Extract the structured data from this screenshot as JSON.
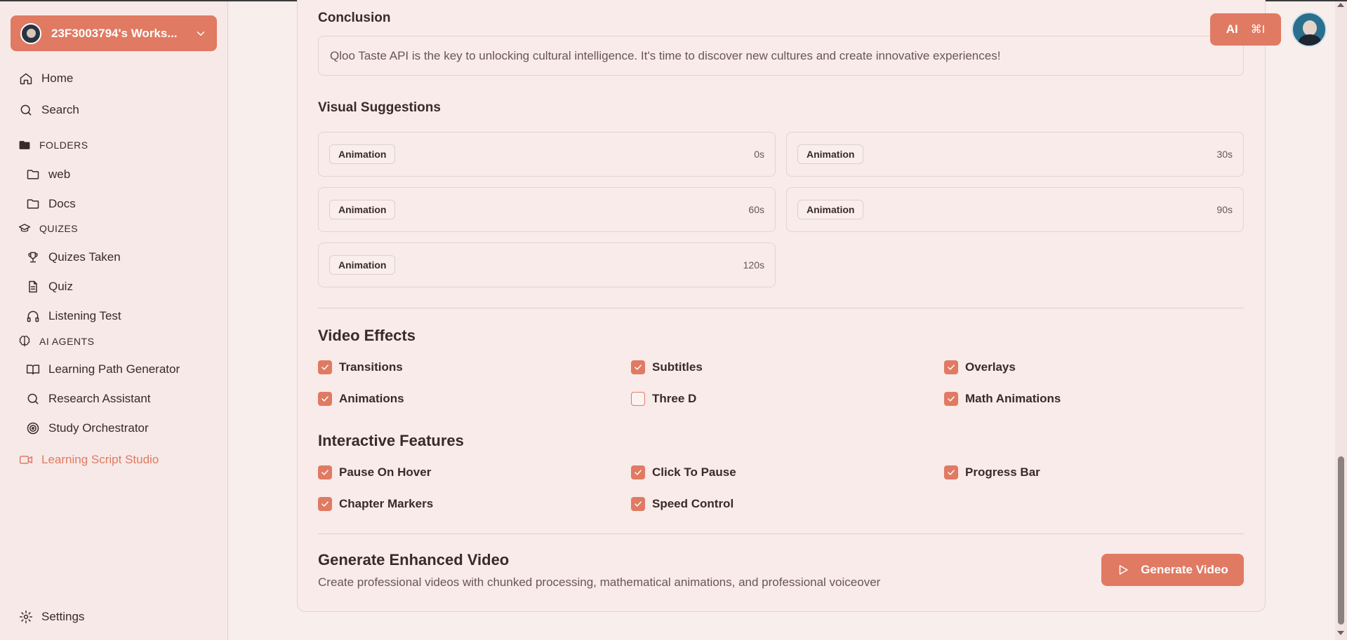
{
  "workspace": {
    "name": "23F3003794's Works..."
  },
  "nav": {
    "home": "Home",
    "search": "Search",
    "folders_header": "FOLDERS",
    "folders": [
      "web",
      "Docs"
    ],
    "quizes_header": "QUIZES",
    "quizes": [
      "Quizes Taken",
      "Quiz",
      "Listening Test"
    ],
    "agents_header": "AI AGENTS",
    "agents": [
      "Learning Path Generator",
      "Research Assistant",
      "Study Orchestrator"
    ],
    "active": "Learning Script Studio",
    "settings": "Settings"
  },
  "topbar": {
    "ai_label": "AI",
    "shortcut": "⌘I"
  },
  "conclusion": {
    "heading": "Conclusion",
    "text": "Qloo Taste API is the key to unlocking cultural intelligence. It's time to discover new cultures and create innovative experiences!"
  },
  "visual_suggestions": {
    "heading": "Visual Suggestions",
    "items": [
      {
        "label": "Animation",
        "time": "0s"
      },
      {
        "label": "Animation",
        "time": "30s"
      },
      {
        "label": "Animation",
        "time": "60s"
      },
      {
        "label": "Animation",
        "time": "90s"
      },
      {
        "label": "Animation",
        "time": "120s"
      }
    ]
  },
  "video_effects": {
    "heading": "Video Effects",
    "options": [
      {
        "label": "Transitions",
        "checked": true
      },
      {
        "label": "Subtitles",
        "checked": true
      },
      {
        "label": "Overlays",
        "checked": true
      },
      {
        "label": "Animations",
        "checked": true
      },
      {
        "label": "Three D",
        "checked": false
      },
      {
        "label": "Math Animations",
        "checked": true
      }
    ]
  },
  "interactive_features": {
    "heading": "Interactive Features",
    "options": [
      {
        "label": "Pause On Hover",
        "checked": true
      },
      {
        "label": "Click To Pause",
        "checked": true
      },
      {
        "label": "Progress Bar",
        "checked": true
      },
      {
        "label": "Chapter Markers",
        "checked": true
      },
      {
        "label": "Speed Control",
        "checked": true
      }
    ]
  },
  "generate": {
    "title": "Generate Enhanced Video",
    "description": "Create professional videos with chunked processing, mathematical animations, and professional voiceover",
    "button_label": "Generate Video"
  },
  "colors": {
    "accent": "#e07a63",
    "background": "#f8eeec",
    "text": "#3a2a28"
  }
}
